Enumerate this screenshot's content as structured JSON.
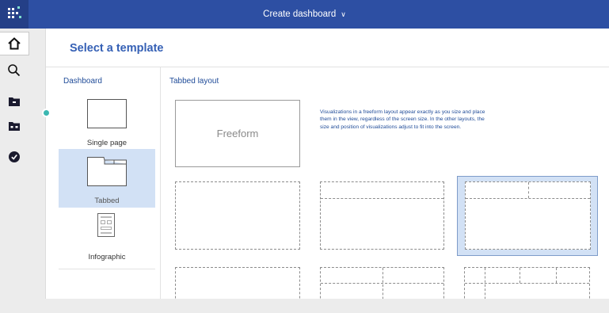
{
  "topbar": {
    "title": "Create dashboard",
    "dropdown_icon": "chevron-down-icon",
    "background": "#2d4fa3"
  },
  "rail": {
    "items": [
      "home-icon",
      "search-icon",
      "folder-icon",
      "team-folder-icon",
      "recent-icon"
    ],
    "notification_color": "#3bb7b1"
  },
  "page": {
    "title": "Select a template"
  },
  "dashboard_types": {
    "heading": "Dashboard",
    "options": [
      {
        "label": "Single page",
        "selected": false
      },
      {
        "label": "Tabbed",
        "selected": true
      },
      {
        "label": "Infographic",
        "selected": false
      }
    ]
  },
  "layouts": {
    "heading": "Tabbed layout",
    "freeform_label": "Freeform",
    "description": "Visualizations in a freeform layout appear exactly as you size and place them in the view, regardless of the screen size. In the other layouts, the size and position of visualizations adjust to fit into the screen."
  },
  "colors": {
    "accent": "#3560b5",
    "selection": "#d2e1f5"
  }
}
